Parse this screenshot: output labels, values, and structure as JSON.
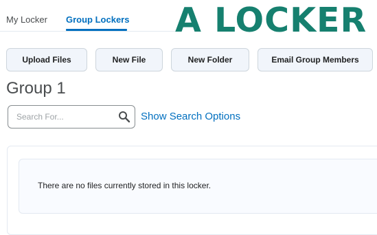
{
  "tabs": {
    "my_locker": "My Locker",
    "group_lockers": "Group Lockers"
  },
  "overlay": {
    "title": "A LOCKER",
    "color": "#16806f"
  },
  "toolbar": {
    "upload_label": "Upload Files",
    "new_file_label": "New File",
    "new_folder_label": "New Folder",
    "email_label": "Email Group Members"
  },
  "page": {
    "title": "Group 1"
  },
  "search": {
    "placeholder": "Search For...",
    "value": "",
    "options_label": "Show Search Options"
  },
  "content": {
    "empty_message": "There are no files currently stored in this locker."
  },
  "colors": {
    "link": "#006fbf",
    "button_bg": "#f1f5fb",
    "border": "#cdd5dc"
  },
  "icons": {
    "search": "magnifier-icon"
  }
}
